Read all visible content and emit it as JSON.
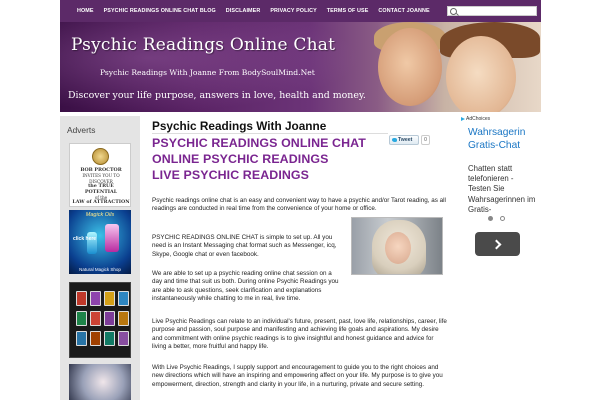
{
  "nav": {
    "items": [
      "HOME",
      "PSYCHIC READINGS ONLINE CHAT BLOG",
      "DISCLAIMER",
      "PRIVACY POLICY",
      "TERMS OF USE",
      "CONTACT JOANNE"
    ],
    "search_placeholder": ""
  },
  "banner": {
    "title": "Psychic Readings Online Chat",
    "subtitle": "Psychic Readings With Joanne From BodySoulMind.Net",
    "tagline": "Discover your life purpose, answers in love, health and money."
  },
  "sidebar": {
    "title": "Adverts",
    "bob_ad": {
      "line1": "BOB PROCTOR",
      "line2": "INVITES YOU TO",
      "line3": "DISCOVER",
      "line4": "the TRUE POTENTIAL",
      "line5": "of the",
      "line6": "LAW of ATTRACTION"
    },
    "magick_ad": {
      "title": "Magick Oils",
      "click": "click here",
      "shop": "Natural Magick Shop"
    }
  },
  "main": {
    "title": "Psychic Readings With Joanne",
    "tweet_label": "Tweet",
    "tweet_count": "0",
    "headings": [
      "PSYCHIC READINGS ONLINE CHAT",
      "ONLINE PSYCHIC READINGS",
      "LIVE PSYCHIC READINGS"
    ],
    "paragraphs": [
      "Psychic readings online chat is an easy and convenient way to have a psychic and/or Tarot reading, as all readings are conducted in real time from the convenience of your home or office.",
      "PSYCHIC READINGS ONLINE CHAT is simple to set up.  All you need is an Instant Messaging chat format such as Messenger, icq, Skype, Google chat or even facebook.",
      "We are able to set up a psychic reading online chat session on a day and time that suit us both. During online Psychic Readings you are able to ask questions, seek clarification and explanations instantaneously while chatting to me in real, live time.",
      "Live Psychic Readings can relate to an individual's future, present, past, love life, relationships, career, life purpose and passion, soul purpose and manifesting and achieving life goals and aspirations.  My desire and commitment with online psychic readings is to give insightful and honest guidance and advice for living a better, more fruitful and happy life.",
      "With  Live Psychic Readings, I supply support and encouragement to guide you to the right choices and new directions which will have an inspiring and empowering affect on your life. My purpose is to give you empowerment, direction, strength and clarity in your life, in a nurturing, private and secure setting."
    ]
  },
  "right_ad": {
    "adchoices": "AdChoices",
    "headline": "Wahrsagerin Gratis-Chat",
    "body": "Chatten statt telefonieren - Testen Sie Wahrsagerinnen im Gratis-"
  },
  "colors": {
    "nav_bg": "#5c2a68",
    "heading_purple": "#7a2590",
    "ad_link_blue": "#1a76c4"
  }
}
